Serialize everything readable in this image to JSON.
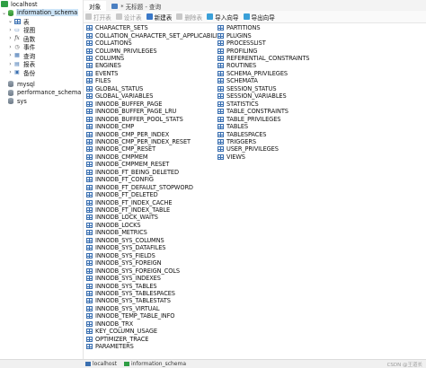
{
  "nav": {
    "connection": "localhost",
    "active_db": "information_schema",
    "groups": [
      {
        "key": "tables",
        "label": "表",
        "icon": "table-icon"
      },
      {
        "key": "views",
        "label": "视图",
        "icon": "view-icon"
      },
      {
        "key": "functions",
        "label": "函数",
        "icon": "function-icon"
      },
      {
        "key": "events",
        "label": "事件",
        "icon": "event-icon"
      },
      {
        "key": "queries",
        "label": "查询",
        "icon": "query-icon"
      },
      {
        "key": "reports",
        "label": "报表",
        "icon": "report-icon"
      },
      {
        "key": "backups",
        "label": "备份",
        "icon": "backup-icon"
      }
    ],
    "other_dbs": [
      "mysql",
      "performance_schema",
      "sys"
    ]
  },
  "tabs": {
    "objects": "对象",
    "query": "* 无标题 - 查询"
  },
  "toolbar": {
    "open": "打开表",
    "design": "设计表",
    "new": "新建表",
    "delete": "删除表",
    "import": "导入向导",
    "export": "导出向导"
  },
  "objects": {
    "col1": [
      "CHARACTER_SETS",
      "COLLATION_CHARACTER_SET_APPLICABILITY",
      "COLLATIONS",
      "COLUMN_PRIVILEGES",
      "COLUMNS",
      "ENGINES",
      "EVENTS",
      "FILES",
      "GLOBAL_STATUS",
      "GLOBAL_VARIABLES",
      "INNODB_BUFFER_PAGE",
      "INNODB_BUFFER_PAGE_LRU",
      "INNODB_BUFFER_POOL_STATS",
      "INNODB_CMP",
      "INNODB_CMP_PER_INDEX",
      "INNODB_CMP_PER_INDEX_RESET",
      "INNODB_CMP_RESET",
      "INNODB_CMPMEM",
      "INNODB_CMPMEM_RESET",
      "INNODB_FT_BEING_DELETED",
      "INNODB_FT_CONFIG",
      "INNODB_FT_DEFAULT_STOPWORD",
      "INNODB_FT_DELETED",
      "INNODB_FT_INDEX_CACHE",
      "INNODB_FT_INDEX_TABLE",
      "INNODB_LOCK_WAITS",
      "INNODB_LOCKS",
      "INNODB_METRICS",
      "INNODB_SYS_COLUMNS",
      "INNODB_SYS_DATAFILES",
      "INNODB_SYS_FIELDS",
      "INNODB_SYS_FOREIGN",
      "INNODB_SYS_FOREIGN_COLS",
      "INNODB_SYS_INDEXES",
      "INNODB_SYS_TABLES",
      "INNODB_SYS_TABLESPACES",
      "INNODB_SYS_TABLESTATS",
      "INNODB_SYS_VIRTUAL",
      "INNODB_TEMP_TABLE_INFO",
      "INNODB_TRX",
      "KEY_COLUMN_USAGE",
      "OPTIMIZER_TRACE",
      "PARAMETERS"
    ],
    "col2": [
      "PARTITIONS",
      "PLUGINS",
      "PROCESSLIST",
      "PROFILING",
      "REFERENTIAL_CONSTRAINTS",
      "ROUTINES",
      "SCHEMA_PRIVILEGES",
      "SCHEMATA",
      "SESSION_STATUS",
      "SESSION_VARIABLES",
      "STATISTICS",
      "TABLE_CONSTRAINTS",
      "TABLE_PRIVILEGES",
      "TABLES",
      "TABLESPACES",
      "TRIGGERS",
      "USER_PRIVILEGES",
      "VIEWS"
    ]
  },
  "statusbar": {
    "connection": "localhost",
    "db": "information_schema",
    "watermark": "CSDN @王道长"
  },
  "colors": {
    "selected": "#cce4f7",
    "table_icon": "#3a6fb0",
    "connection": "#2f9e44"
  }
}
